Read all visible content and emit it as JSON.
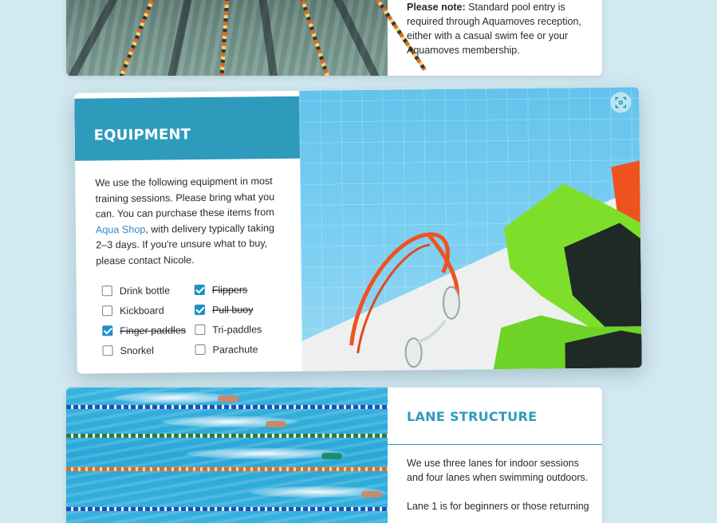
{
  "pool_note": {
    "bold": "Please note:",
    "text": " Standard pool entry is required through Aquamoves reception, either with a casual swim fee or your Aquamoves membership."
  },
  "equipment": {
    "title": "EQUIPMENT",
    "intro_before_link": "We use the following equipment in most training sessions. Please bring what you can. You can purchase these items from ",
    "link_text": "Aqua Shop",
    "intro_after_link": ", with delivery typically taking 2–3 days. If you're unsure what to buy, please contact Nicole.",
    "items": [
      {
        "label": "Drink bottle",
        "checked": false
      },
      {
        "label": "Kickboard",
        "checked": false
      },
      {
        "label": "Finger paddles",
        "checked": true
      },
      {
        "label": "Snorkel",
        "checked": false
      },
      {
        "label": "Flippers",
        "checked": true
      },
      {
        "label": "Pull buoy",
        "checked": true
      },
      {
        "label": "Tri-paddles",
        "checked": false
      },
      {
        "label": "Parachute",
        "checked": false
      }
    ],
    "image_icon": "scan-icon"
  },
  "lane_structure": {
    "title": "LANE STRUCTURE",
    "p1": "We use three lanes for indoor sessions and four lanes when swimming outdoors.",
    "p2": "Lane 1 is for beginners or those returning"
  },
  "colors": {
    "accent": "#2e9bbd",
    "link": "#2f86c7",
    "checkbox_checked": "#1f8fc6",
    "background": "#d3e9f1"
  }
}
